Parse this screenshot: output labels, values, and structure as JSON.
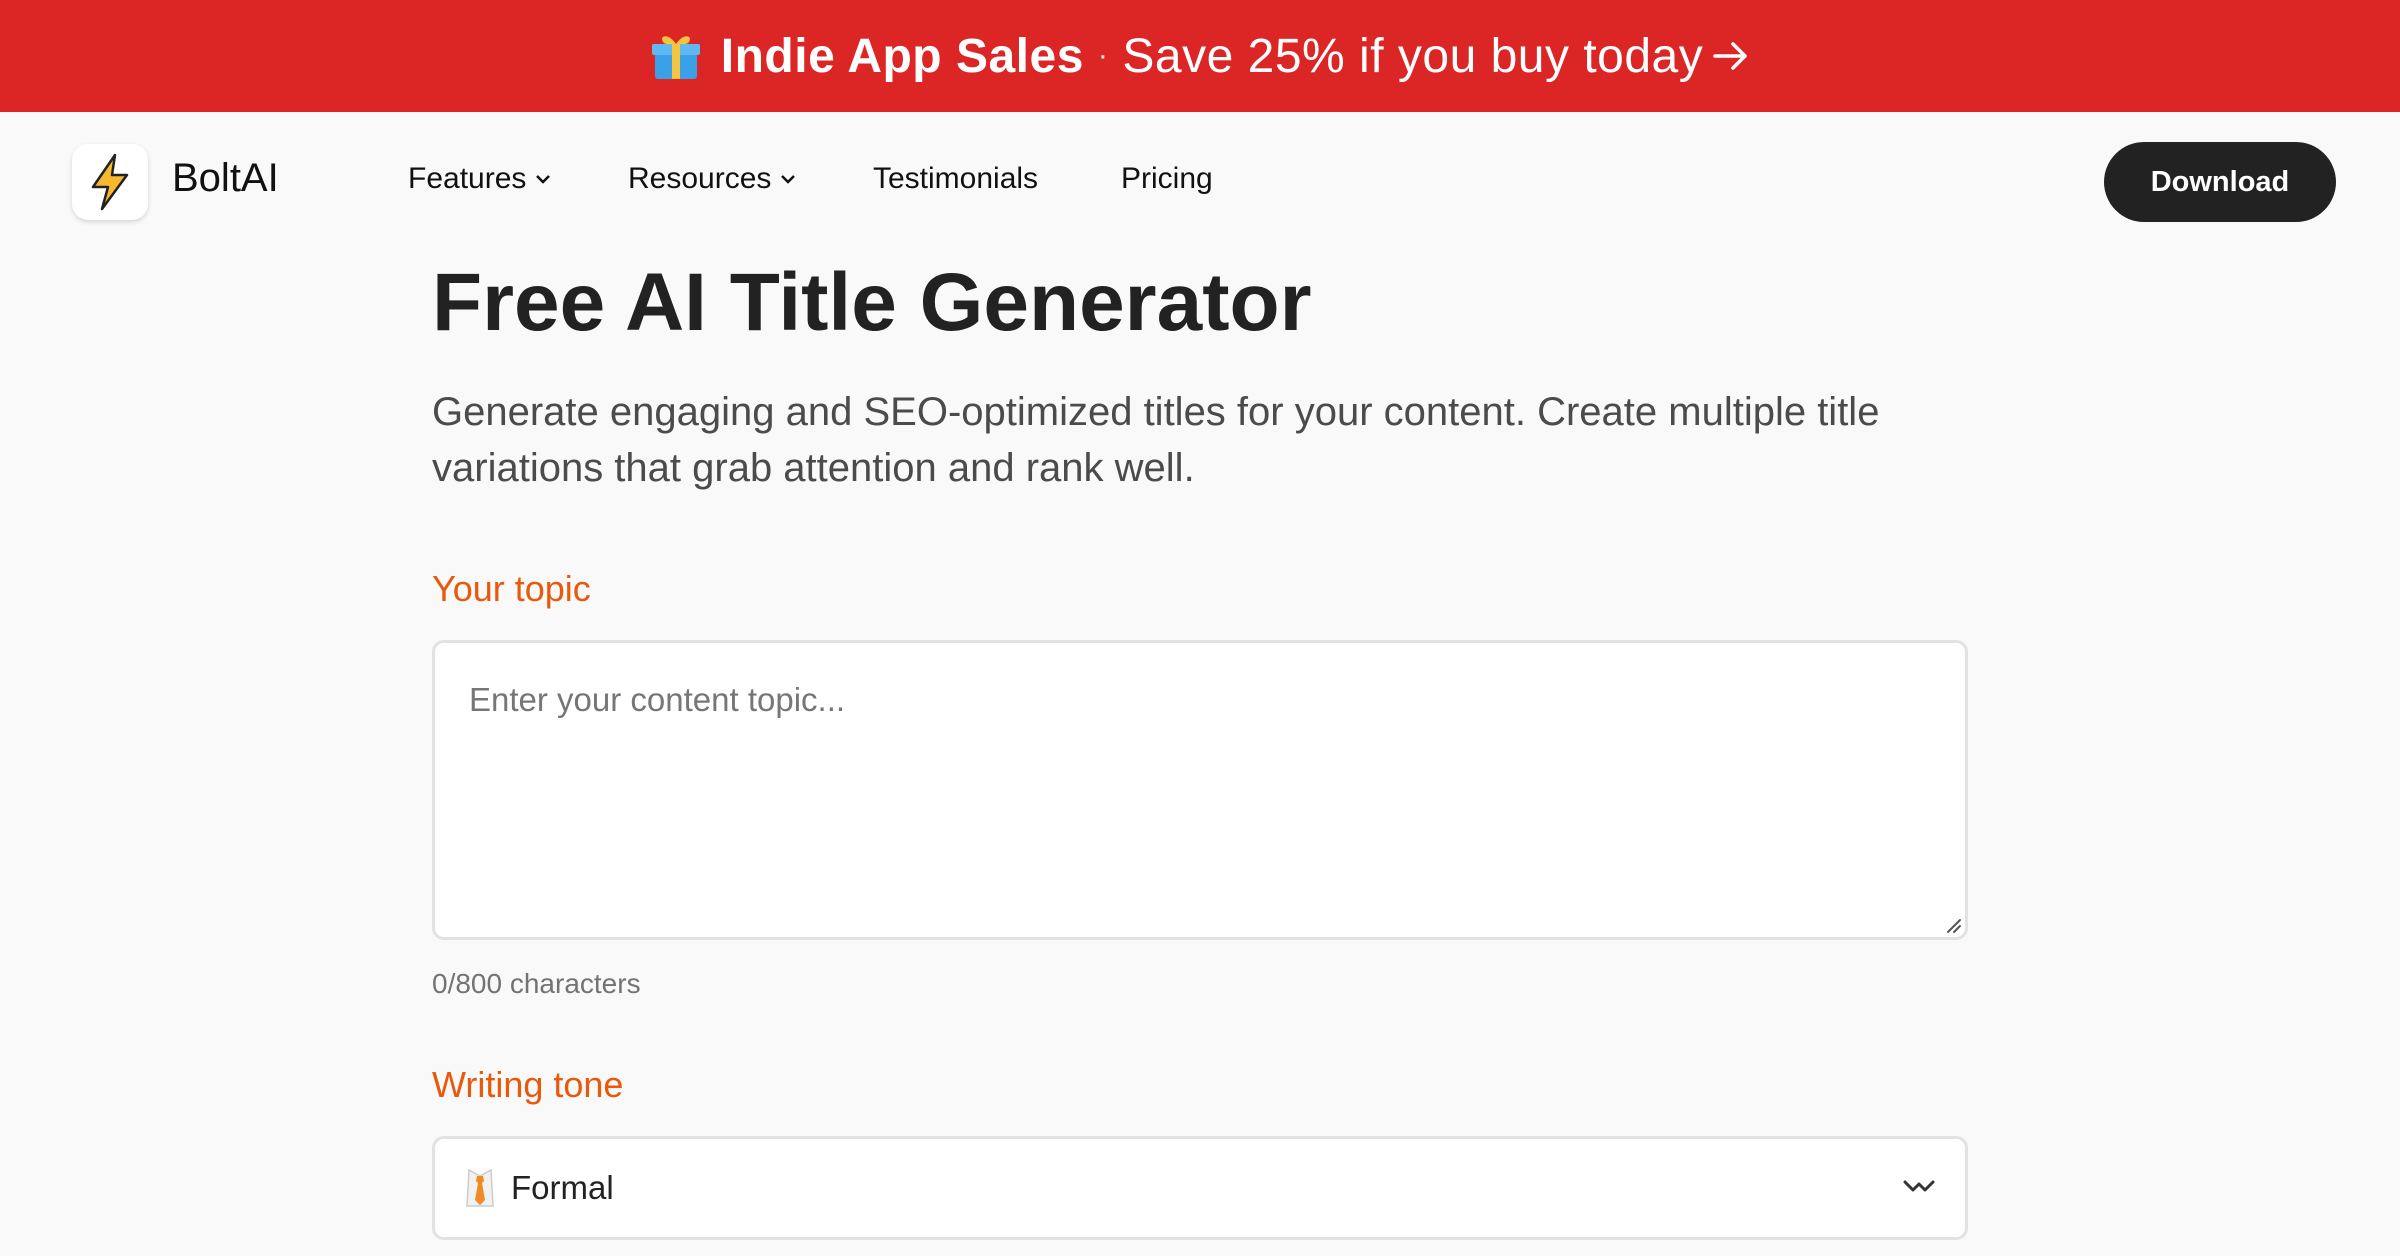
{
  "promo": {
    "bold_text": "Indie App Sales",
    "separator": "·",
    "offer_text": "Save 25% if you buy today"
  },
  "nav": {
    "brand": "BoltAI",
    "links": [
      {
        "label": "Features",
        "has_dropdown": true
      },
      {
        "label": "Resources",
        "has_dropdown": true
      },
      {
        "label": "Testimonials",
        "has_dropdown": false
      },
      {
        "label": "Pricing",
        "has_dropdown": false
      }
    ],
    "download_label": "Download"
  },
  "main": {
    "title": "Free AI Title Generator",
    "subtitle": "Generate engaging and SEO-optimized titles for your content. Create multiple title variations that grab attention and rank well.",
    "topic": {
      "label": "Your topic",
      "placeholder": "Enter your content topic...",
      "value": "",
      "counter": "0/800 characters"
    },
    "tone": {
      "label": "Writing tone",
      "selected": "Formal"
    }
  },
  "colors": {
    "banner": "#dc2626",
    "accent": "#ea580c",
    "button": "#222222",
    "background": "#f9f9f9"
  },
  "icons": [
    "gift-icon",
    "arrow-right-icon",
    "bolt-logo-icon",
    "chevron-down-icon",
    "necktie-icon",
    "resize-grip-icon"
  ]
}
